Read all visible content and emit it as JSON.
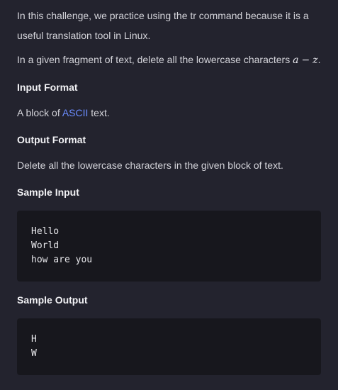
{
  "intro": {
    "text": "In this challenge, we practice using the tr command because it is a useful translation tool in Linux."
  },
  "task": {
    "text_before": "In a given fragment of text, delete all the lowercase characters ",
    "math_a": "a",
    "math_minus": "−",
    "math_z": "z",
    "text_after": "."
  },
  "input_format": {
    "heading": "Input Format",
    "text_before": "A block of ",
    "link_text": "ASCII",
    "text_after": " text."
  },
  "output_format": {
    "heading": "Output Format",
    "text": "Delete all the lowercase characters in the given block of text."
  },
  "sample_input": {
    "heading": "Sample Input",
    "lines": [
      "Hello",
      "World",
      "how are you"
    ]
  },
  "sample_output": {
    "heading": "Sample Output",
    "lines": [
      "H",
      "W"
    ]
  },
  "colors": {
    "background": "#23232e",
    "code_background": "#17171d",
    "link": "#6b8cff",
    "heading": "#f2f2f5",
    "text": "#d4d4da"
  }
}
